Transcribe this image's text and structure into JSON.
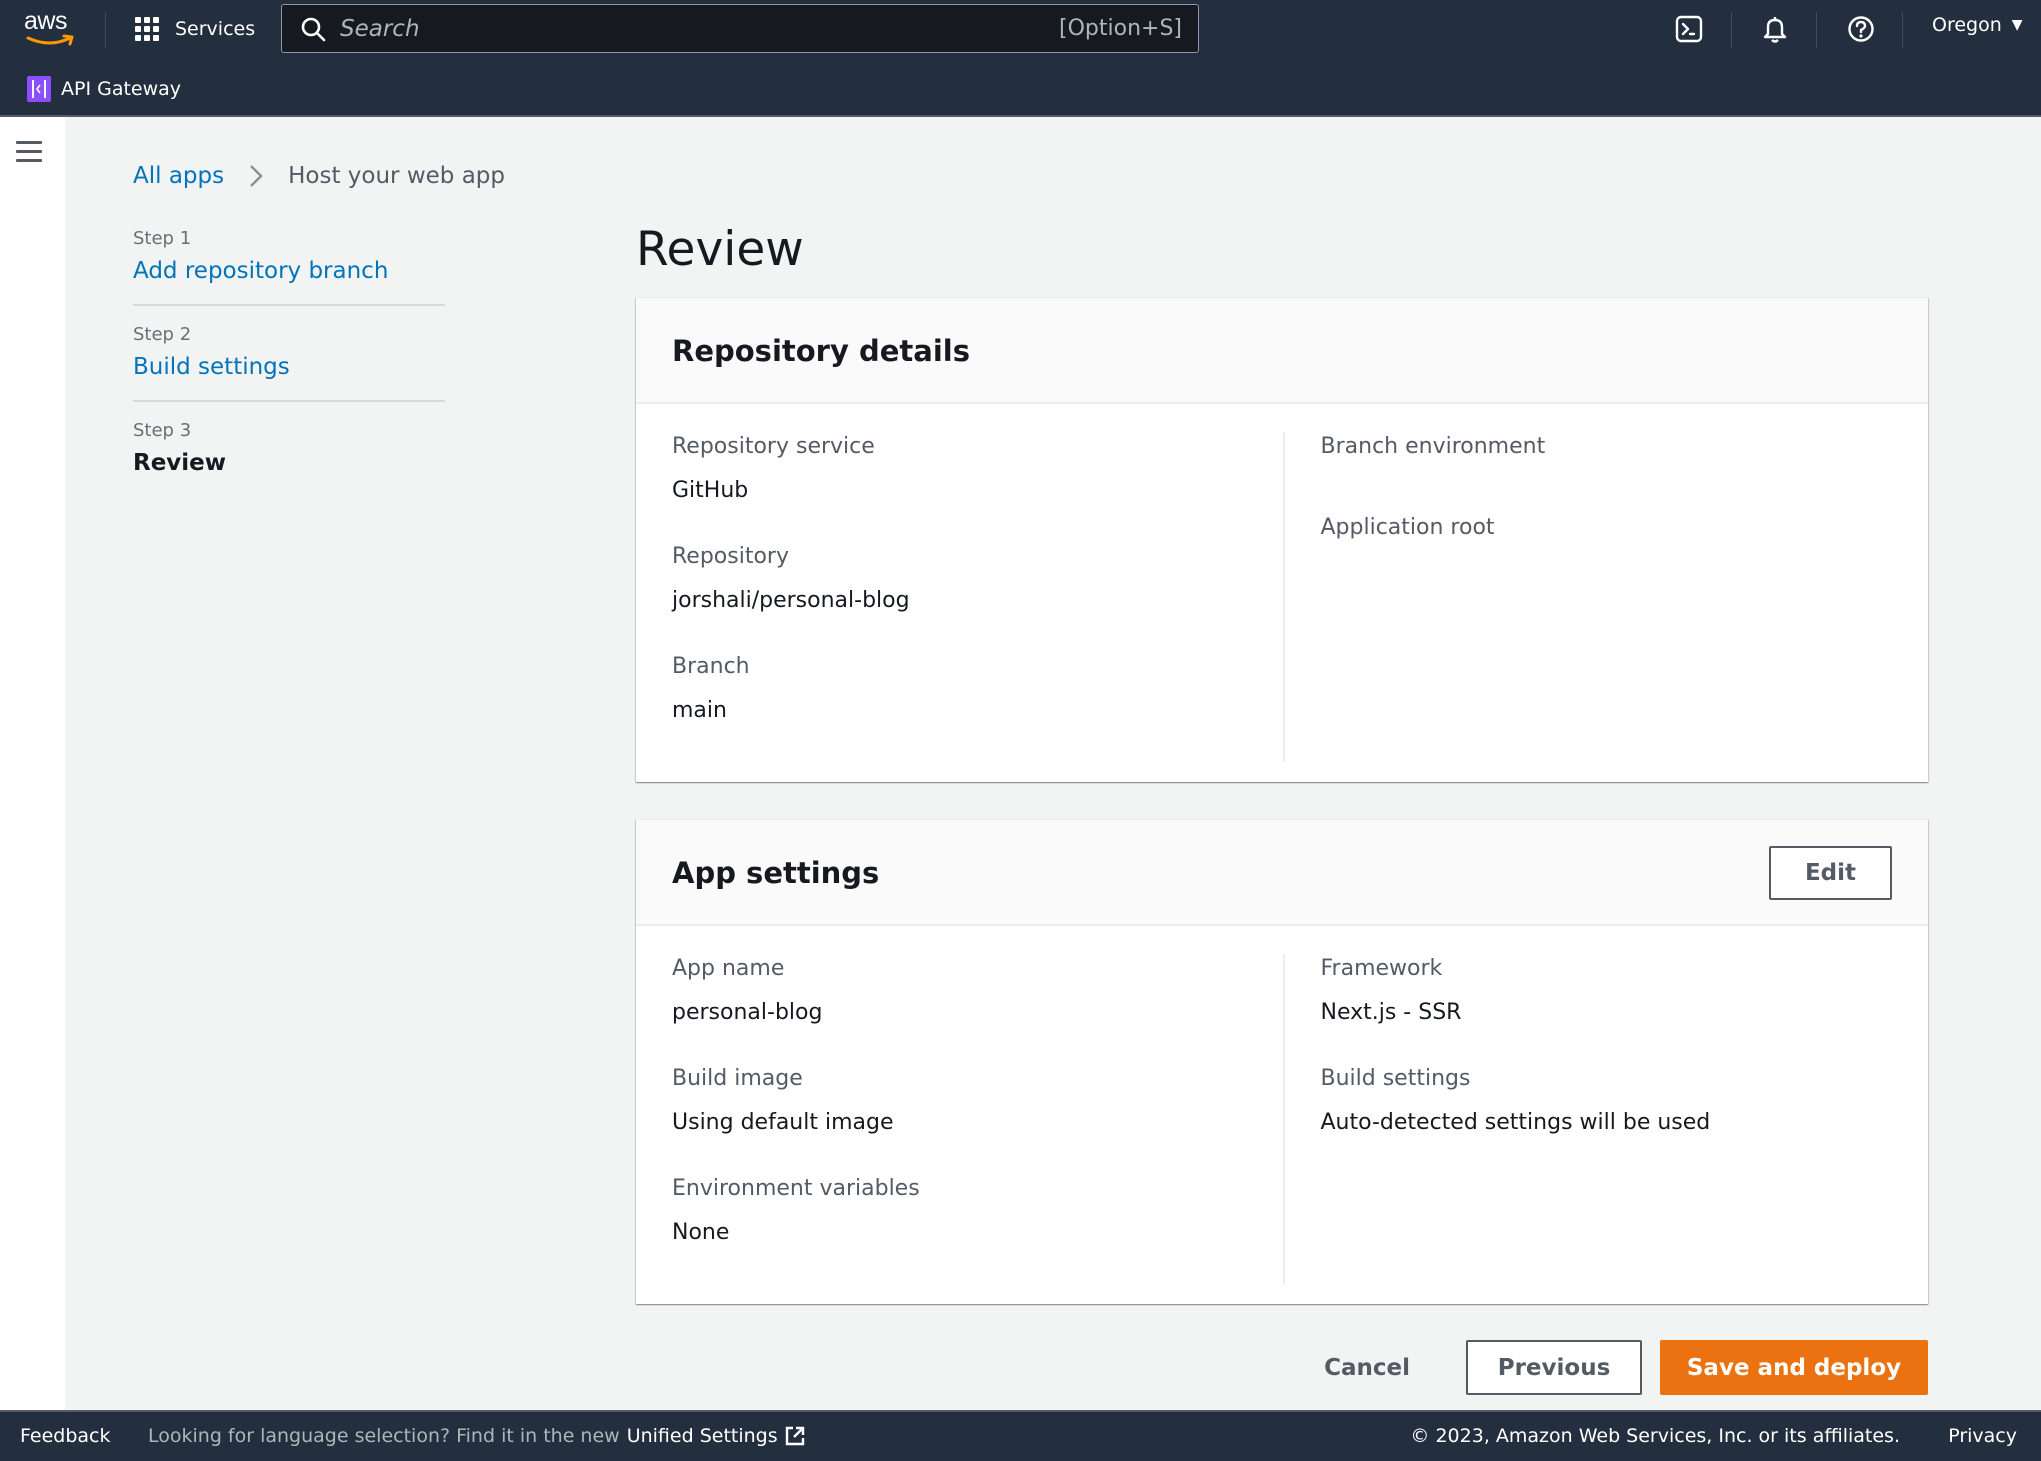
{
  "header": {
    "logo": "aws",
    "services_label": "Services",
    "search": {
      "placeholder": "Search",
      "value": "",
      "shortcut": "[Option+S]"
    },
    "icons": [
      "cloudshell-icon",
      "bell-icon",
      "help-icon"
    ],
    "region": "Oregon",
    "service_name": "API Gateway"
  },
  "breadcrumb": {
    "items": [
      {
        "label": "All apps",
        "link": true
      },
      {
        "label": "Host your web app",
        "link": false
      }
    ]
  },
  "steps": [
    {
      "number": "Step 1",
      "title": "Add repository branch",
      "current": false
    },
    {
      "number": "Step 2",
      "title": "Build settings",
      "current": false
    },
    {
      "number": "Step 3",
      "title": "Review",
      "current": true
    }
  ],
  "page_title": "Review",
  "repository_details": {
    "title": "Repository details",
    "left": [
      {
        "key": "Repository service",
        "value": "GitHub"
      },
      {
        "key": "Repository",
        "value": "jorshali/personal-blog"
      },
      {
        "key": "Branch",
        "value": "main"
      }
    ],
    "right": [
      {
        "key": "Branch environment",
        "value": ""
      },
      {
        "key": "Application root",
        "value": ""
      }
    ]
  },
  "app_settings": {
    "title": "App settings",
    "edit_label": "Edit",
    "left": [
      {
        "key": "App name",
        "value": "personal-blog"
      },
      {
        "key": "Build image",
        "value": "Using default image"
      },
      {
        "key": "Environment variables",
        "value": "None"
      }
    ],
    "right": [
      {
        "key": "Framework",
        "value": "Next.js - SSR"
      },
      {
        "key": "Build settings",
        "value": "Auto-detected settings will be used"
      }
    ]
  },
  "actions": {
    "cancel": "Cancel",
    "previous": "Previous",
    "primary": "Save and deploy"
  },
  "colors": {
    "primary_button": "#ec7211",
    "link": "#0073bb",
    "nav_bg": "#232f3e",
    "service_badge": "#8c4fff"
  },
  "footer": {
    "feedback": "Feedback",
    "language_prompt": "Looking for language selection? Find it in the new",
    "unified_settings": "Unified Settings",
    "copyright": "© 2023, Amazon Web Services, Inc. or its affiliates.",
    "privacy": "Privacy"
  }
}
